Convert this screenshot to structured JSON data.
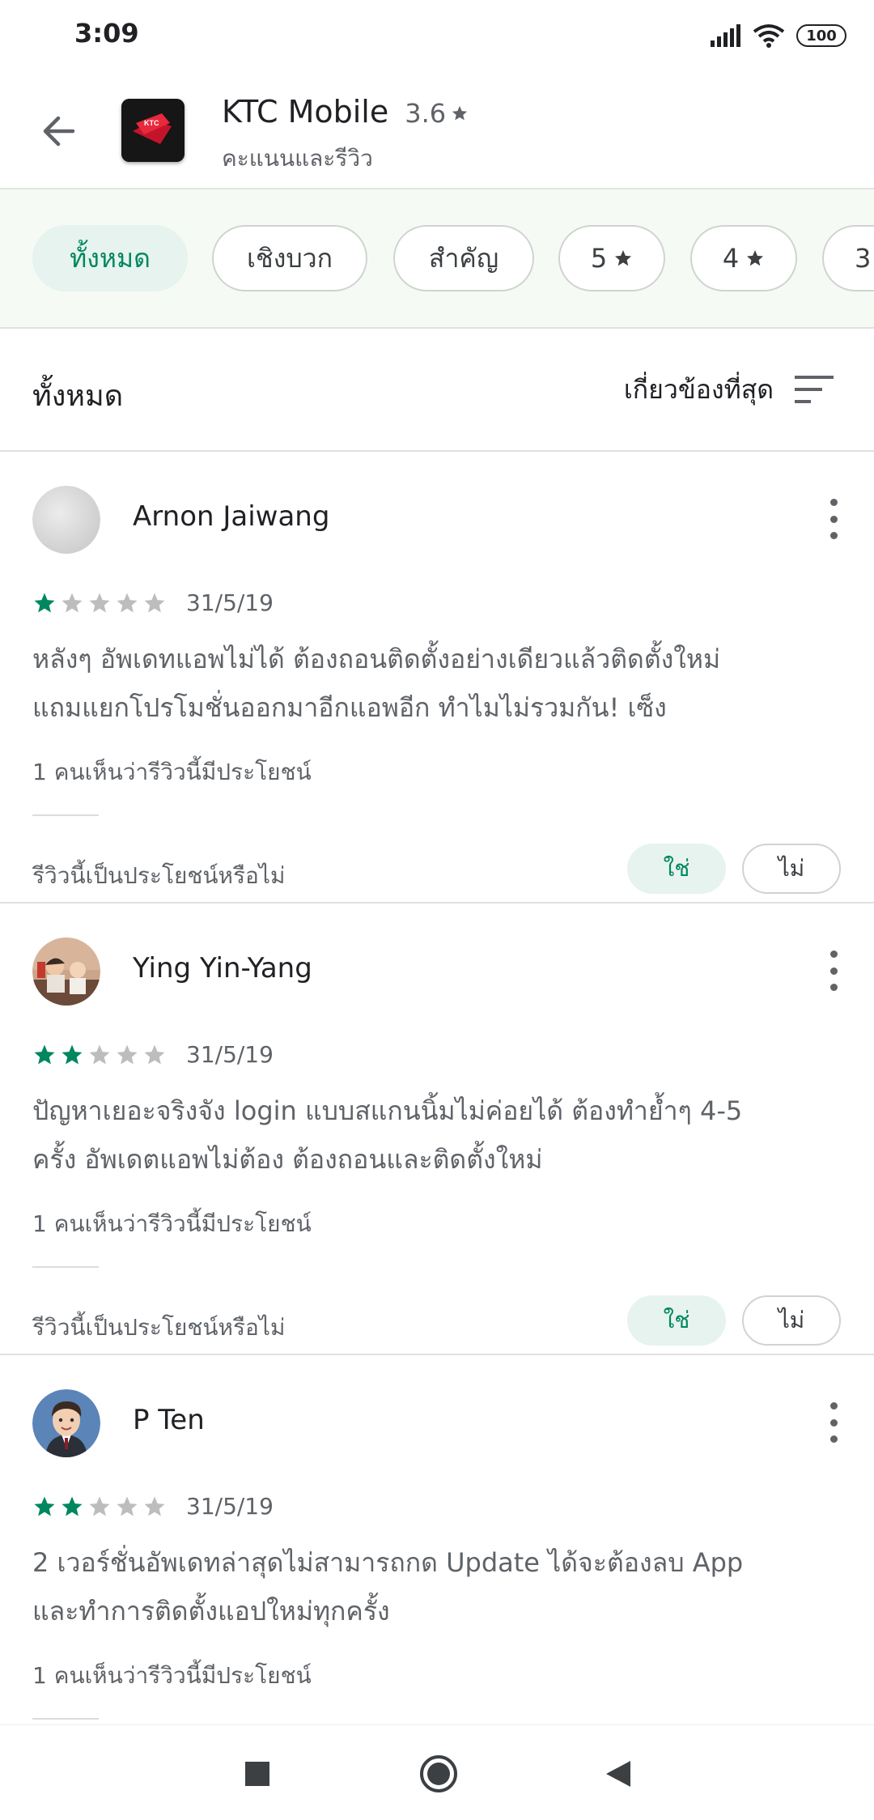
{
  "status_bar": {
    "time": "3:09",
    "battery": "100",
    "icons": [
      "signal-icon",
      "wifi-icon",
      "battery-icon"
    ]
  },
  "app": {
    "name": "KTC Mobile",
    "rating": "3.6",
    "subtitle": "คะแนนและรีวิว",
    "icon_label": "KTC"
  },
  "filters": [
    {
      "label": "ทั้งหมด",
      "active": true
    },
    {
      "label": "เชิงบวก",
      "active": false
    },
    {
      "label": "สำคัญ",
      "active": false
    },
    {
      "label": "5",
      "star": true,
      "active": false
    },
    {
      "label": "4",
      "star": true,
      "active": false
    },
    {
      "label": "3",
      "star": true,
      "active": false
    }
  ],
  "sort": {
    "title": "ทั้งหมด",
    "label": "เกี่ยวข้องที่สุด"
  },
  "reviews": [
    {
      "name": "Arnon Jaiwang",
      "rating": 1,
      "date": "31/5/19",
      "text_line1": "หลังๆ อัพเดทแอพไม่ได้ ต้องถอนติดตั้งอย่างเดียวแล้วติดตั้งใหม่",
      "text_line2": "แถมแยกโปรโมชั่นออกมาอีกแอพอีก ทำไมไม่รวมกัน! เซ็ง",
      "helpful": "1 คนเห็นว่ารีวิวนี้มีประโยชน์",
      "question": "รีวิวนี้เป็นประโยชน์หรือไม่",
      "yes": "ใช่",
      "no": "ไม่"
    },
    {
      "name": "Ying Yin-Yang",
      "rating": 2,
      "date": "31/5/19",
      "text_line1": "ปัญหาเยอะจริงจัง login แบบสแกนนิ้มไม่ค่อยได้ ต้องทำย้ำๆ 4-5",
      "text_line2": "ครั้ง อัพเดตแอพไม่ต้อง ต้องถอนและติดตั้งใหม่",
      "helpful": "1 คนเห็นว่ารีวิวนี้มีประโยชน์",
      "question": "รีวิวนี้เป็นประโยชน์หรือไม่",
      "yes": "ใช่",
      "no": "ไม่"
    },
    {
      "name": "P Ten",
      "rating": 2,
      "date": "31/5/19",
      "text_line1": "2 เวอร์ชั่นอัพเดทล่าสุดไม่สามารถกด Update ได้จะต้องลบ App",
      "text_line2": "และทำการติดตั้งแอปใหม่ทุกครั้ง",
      "helpful": "1 คนเห็นว่ารีวิวนี้มีประโยชน์"
    }
  ],
  "colors": {
    "accent": "#01875f",
    "chip_active_bg": "#e6f3ee",
    "star_empty": "#bdbdbd",
    "chipbar_bg": "#f5fbf4"
  },
  "nav": [
    "square-icon",
    "home-circle-icon",
    "back-triangle-icon"
  ]
}
